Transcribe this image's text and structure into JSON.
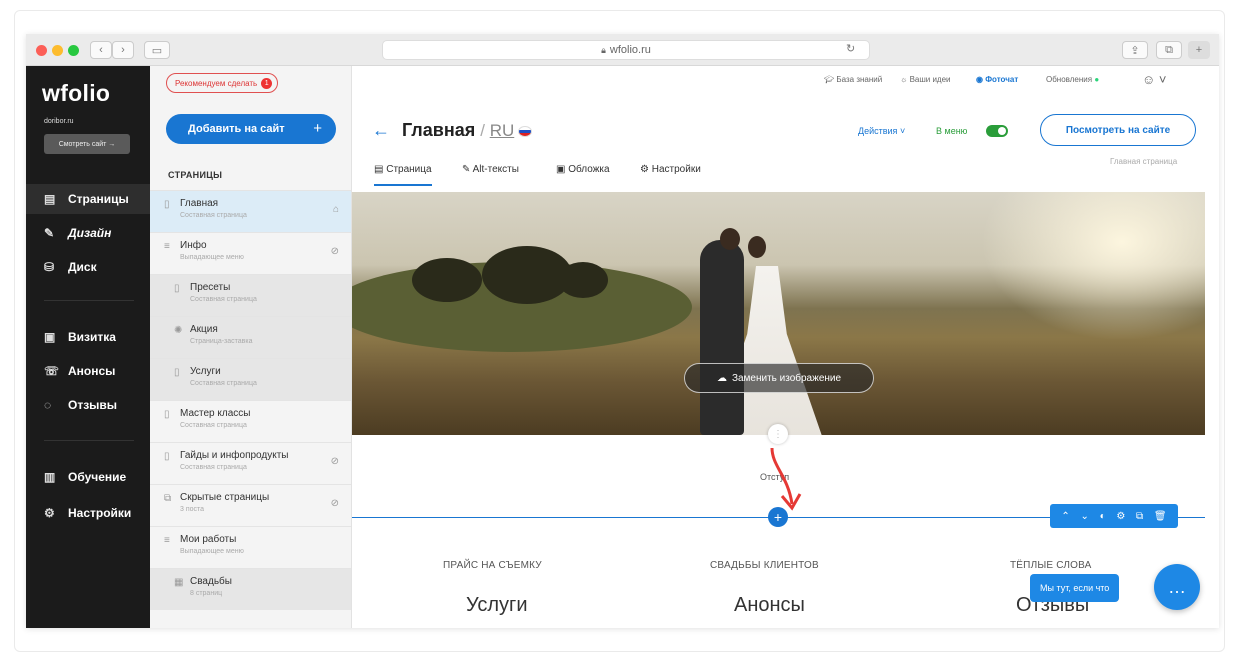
{
  "browser": {
    "url": "wfolio.ru"
  },
  "brand": {
    "logo": "wfolio",
    "domain": "doribor.ru",
    "view_site": "Смотреть сайт →"
  },
  "nav": {
    "items": [
      {
        "label": "Страницы",
        "icon": "page-icon"
      },
      {
        "label": "Дизайн",
        "icon": "brush-icon"
      },
      {
        "label": "Диск",
        "icon": "disk-icon"
      },
      {
        "label": "Визитка",
        "icon": "card-icon"
      },
      {
        "label": "Анонсы",
        "icon": "megaphone-icon"
      },
      {
        "label": "Отзывы",
        "icon": "comments-icon"
      },
      {
        "label": "Обучение",
        "icon": "book-icon"
      },
      {
        "label": "Настройки",
        "icon": "gear-icon"
      }
    ]
  },
  "panel": {
    "recommend": "Рекомендуем сделать",
    "recommend_count": "1",
    "add_button": "Добавить на сайт",
    "pages_heading": "СТРАНИЦЫ",
    "pages": [
      {
        "title": "Главная",
        "subtitle": "Составная страница"
      },
      {
        "title": "Инфо",
        "subtitle": "Выпадающее меню"
      },
      {
        "title": "Пресеты",
        "subtitle": "Составная страница"
      },
      {
        "title": "Акция",
        "subtitle": "Страница-заставка"
      },
      {
        "title": "Услуги",
        "subtitle": "Составная страница"
      },
      {
        "title": "Мастер классы",
        "subtitle": "Составная страница"
      },
      {
        "title": "Гайды и инфопродукты",
        "subtitle": "Составная страница"
      },
      {
        "title": "Скрытые страницы",
        "subtitle": "3 поста"
      },
      {
        "title": "Мои работы",
        "subtitle": "Выпадающее меню"
      },
      {
        "title": "Свадьбы",
        "subtitle": "8 страниц"
      }
    ]
  },
  "topbar": {
    "knowledge": "База знаний",
    "ideas": "Ваши идеи",
    "photochat": "Фоточат",
    "updates": "Обновления"
  },
  "page": {
    "title": "Главная",
    "lang": "RU",
    "actions": "Действия",
    "in_menu": "В меню",
    "view_on_site": "Посмотреть на сайте",
    "home_page_label": "Главная страница",
    "tabs": [
      "Страница",
      "Alt-тексты",
      "Обложка",
      "Настройки"
    ],
    "replace_image": "Заменить изображение",
    "spacing": "Отступ",
    "columns": [
      {
        "heading": "ПРАЙС НА СЪЕМКУ",
        "title": "Услуги"
      },
      {
        "heading": "СВАДЬБЫ КЛИЕНТОВ",
        "title": "Анонсы"
      },
      {
        "heading": "ТЁПЛЫЕ СЛОВА",
        "title": "Отзывы"
      }
    ]
  },
  "chat": {
    "tooltip": "Мы тут, если что"
  },
  "colors": {
    "accent": "#1976d2",
    "sidebar": "#1b1b1b",
    "toggle_on": "#2a9d3a",
    "alert": "#e33333"
  }
}
